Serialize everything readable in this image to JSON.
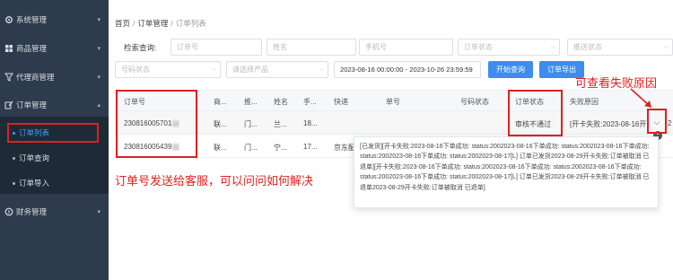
{
  "sidebar": {
    "items": [
      {
        "label": "系统管理",
        "icon": "gear-icon"
      },
      {
        "label": "商品管理",
        "icon": "grid-icon"
      },
      {
        "label": "代理商管理",
        "icon": "funnel-icon"
      },
      {
        "label": "订单管理",
        "icon": "edit-icon"
      },
      {
        "label": "财务管理",
        "icon": "coin-icon"
      }
    ],
    "submenu": [
      {
        "label": "订单列表",
        "active": true
      },
      {
        "label": "订单查询",
        "active": false
      },
      {
        "label": "订单导入",
        "active": false
      }
    ]
  },
  "breadcrumb": {
    "home": "首页",
    "parent": "订单管理",
    "current": "订单列表"
  },
  "search": {
    "label": "检索查询:",
    "order_no_placeholder": "订单号",
    "name_placeholder": "姓名",
    "phone_placeholder": "手机号",
    "order_status_placeholder": "订单状态",
    "push_status_placeholder": "推送状态",
    "number_status_placeholder": "号码状态",
    "product_placeholder": "请选择产品",
    "date_range": "2023-08-16 00:00:00 - 2023-10-26 23:59:59",
    "search_button": "开始查询",
    "export_button": "订单导出"
  },
  "table": {
    "headers": [
      "订单号",
      "商...",
      "推...",
      "姓名",
      "手...",
      "快递",
      "单号",
      "号码状态",
      "订单状态",
      "失败原因"
    ],
    "rows": [
      {
        "order_no": "230816005701",
        "c2": "联...",
        "c3": "门...",
        "c4": "兰...",
        "c5": "18...",
        "c6": "",
        "c7": "",
        "c8": "",
        "status": "审核不通过",
        "reason": "[开卡失败:2023-08-16开..."
      },
      {
        "order_no": "230816005439",
        "c2": "联...",
        "c3": "门...",
        "c4": "宁...",
        "c5": "17...",
        "c6": "京东配...",
        "c7": "",
        "c8": "",
        "status": "",
        "reason": ""
      }
    ],
    "edge_value": "2"
  },
  "popup": {
    "text": "[已发货][开卡失败:2023-08-16下单成功: status:2002023-08-16下单成功: status:2002023-08-16下单成功: status:2002023-08-16下单成功: status:2002023-08-17[L] 订单已发货2023-08-29开卡失败:订单被取消 已退单][开卡失败:2023-08-16下单成功: status:2002023-08-16下单成功: status:2002023-08-16下单成功: status:2002023-08-16下单成功: status:2002023-08-17[L] 订单已发货2023-08-29开卡失败:订单被取消 已退单2023-08-29开卡失败:订单被取消 已退单]"
  },
  "annotations": {
    "left_note": "订单号发送给客服，可以问问如何解决",
    "right_note": "可查看失败原因"
  },
  "colors": {
    "accent": "#3d8cf0",
    "sidebar": "#2e3b4c",
    "annotation": "#e02020"
  }
}
